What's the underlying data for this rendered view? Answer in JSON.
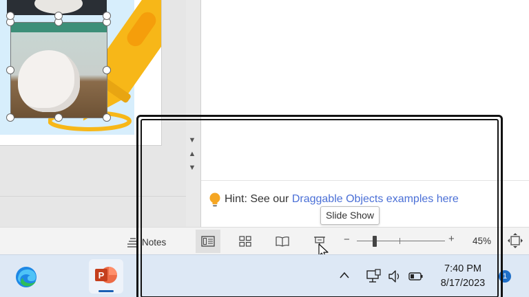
{
  "hint": {
    "prefix": "Hint: See our ",
    "link_text": "Draggable Objects examples here"
  },
  "statusbar": {
    "notes_label": "Notes",
    "zoom_minus": "−",
    "zoom_plus": "+",
    "zoom_percent": "45%",
    "zoom_level": 0.45
  },
  "tooltip": {
    "text": "Slide Show"
  },
  "taskbar": {
    "time": "7:40 PM",
    "date": "8/17/2023",
    "notification_count": "1",
    "tray_chevron": "^"
  },
  "icons": {
    "hint": "lightbulb-icon",
    "notes": "notes-icon",
    "normal_view": "normal-view-icon",
    "slide_sorter": "slide-sorter-icon",
    "reading_view": "reading-view-icon",
    "slide_show": "slide-show-icon",
    "fit": "fit-to-window-icon",
    "edge": "edge-icon",
    "powerpoint": "powerpoint-icon",
    "network": "network-icon",
    "volume": "volume-icon",
    "battery": "battery-icon"
  },
  "colors": {
    "accent": "#1a5fb4",
    "link": "#4a6fd6",
    "crayon": "#f7b718",
    "hint_bulb": "#f5a623",
    "slide_bg": "#d7eefc"
  }
}
